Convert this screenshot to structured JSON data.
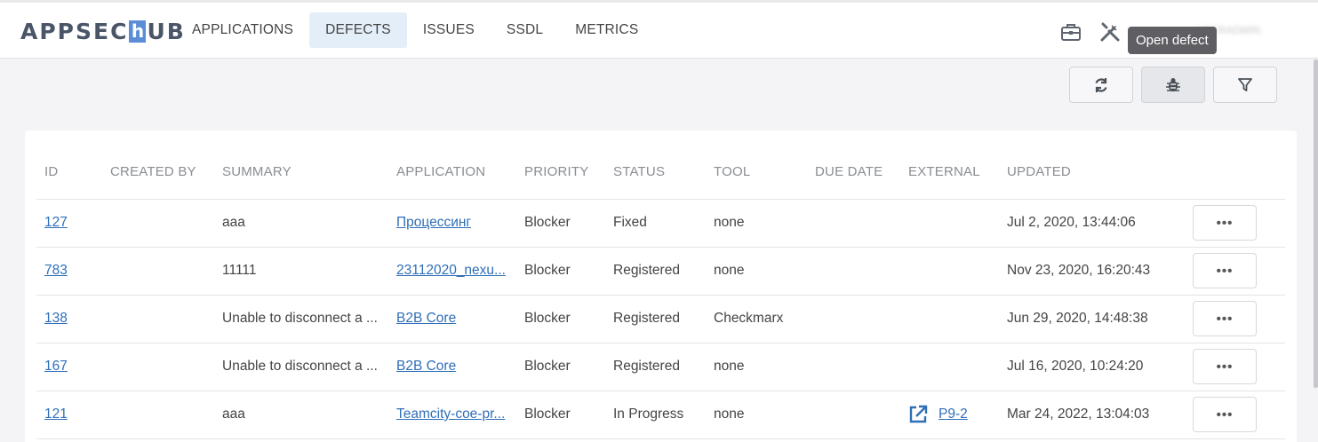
{
  "app": {
    "logo_left": "APPSEC",
    "logo_h": "h",
    "logo_right": "UB",
    "user_name": "USERADMIN"
  },
  "nav": {
    "items": [
      {
        "label": "APPLICATIONS"
      },
      {
        "label": "DEFECTS",
        "active": true
      },
      {
        "label": "ISSUES"
      },
      {
        "label": "SSDL"
      },
      {
        "label": "METRICS"
      }
    ]
  },
  "tooltip": {
    "text": "Open defect"
  },
  "toolbar": {
    "buttons": [
      "refresh-icon",
      "bug-icon",
      "filter-icon"
    ]
  },
  "table": {
    "columns": [
      "ID",
      "CREATED BY",
      "SUMMARY",
      "APPLICATION",
      "PRIORITY",
      "STATUS",
      "TOOL",
      "DUE DATE",
      "EXTERNAL",
      "UPDATED"
    ],
    "rows": [
      {
        "id": "127",
        "created_by": "",
        "summary": "aaa",
        "application": "Процессинг",
        "priority": "Blocker",
        "status": "Fixed",
        "tool": "none",
        "due_date": "",
        "external": "",
        "updated": "Jul 2, 2020, 13:44:06",
        "more": "•••"
      },
      {
        "id": "783",
        "created_by": "",
        "summary": "11111",
        "application": "23112020_nexu...",
        "priority": "Blocker",
        "status": "Registered",
        "tool": "none",
        "due_date": "",
        "external": "",
        "updated": "Nov 23, 2020, 16:20:43",
        "more": "•••"
      },
      {
        "id": "138",
        "created_by": "",
        "summary": "Unable to disconnect a ...",
        "application": "B2B Core",
        "priority": "Blocker",
        "status": "Registered",
        "tool": "Checkmarx",
        "due_date": "",
        "external": "",
        "updated": "Jun 29, 2020, 14:48:38",
        "more": "•••"
      },
      {
        "id": "167",
        "created_by": "",
        "summary": "Unable to disconnect a ...",
        "application": "B2B Core",
        "priority": "Blocker",
        "status": "Registered",
        "tool": "none",
        "due_date": "",
        "external": "",
        "updated": "Jul 16, 2020, 10:24:20",
        "more": "•••"
      },
      {
        "id": "121",
        "created_by": "",
        "summary": "aaa",
        "application": "Teamcity-coe-pr...",
        "priority": "Blocker",
        "status": "In Progress",
        "tool": "none",
        "due_date": "",
        "external": "P9-2",
        "updated": "Mar 24, 2022, 13:04:03",
        "more": "•••"
      }
    ]
  },
  "colors": {
    "accent": "#2f6fb8",
    "nav_active_bg": "#e3eef9",
    "logo_h": "#5b8dd6"
  }
}
